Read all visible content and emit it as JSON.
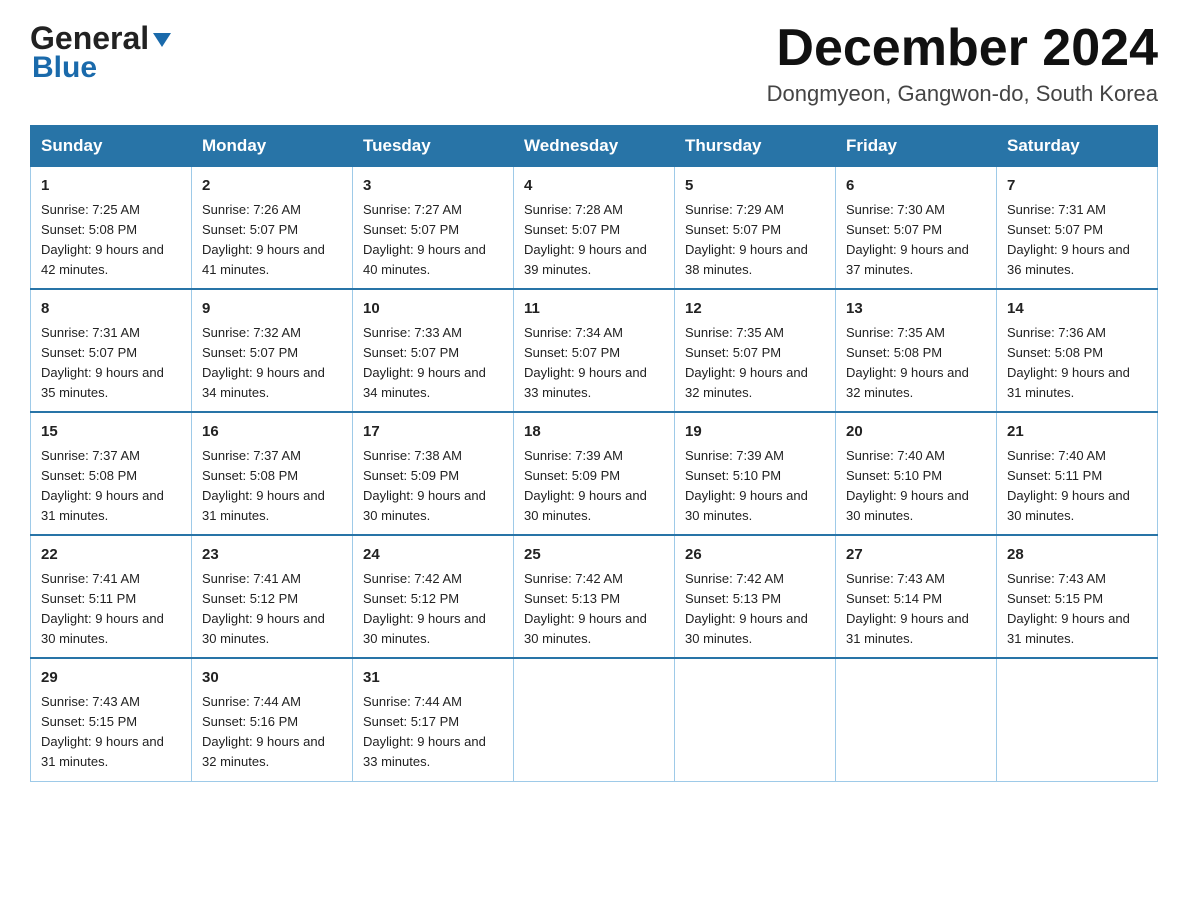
{
  "header": {
    "logo_line1": "General",
    "logo_line2": "Blue",
    "month_title": "December 2024",
    "location": "Dongmyeon, Gangwon-do, South Korea"
  },
  "weekdays": [
    "Sunday",
    "Monday",
    "Tuesday",
    "Wednesday",
    "Thursday",
    "Friday",
    "Saturday"
  ],
  "weeks": [
    [
      {
        "day": "1",
        "sunrise": "Sunrise: 7:25 AM",
        "sunset": "Sunset: 5:08 PM",
        "daylight": "Daylight: 9 hours and 42 minutes."
      },
      {
        "day": "2",
        "sunrise": "Sunrise: 7:26 AM",
        "sunset": "Sunset: 5:07 PM",
        "daylight": "Daylight: 9 hours and 41 minutes."
      },
      {
        "day": "3",
        "sunrise": "Sunrise: 7:27 AM",
        "sunset": "Sunset: 5:07 PM",
        "daylight": "Daylight: 9 hours and 40 minutes."
      },
      {
        "day": "4",
        "sunrise": "Sunrise: 7:28 AM",
        "sunset": "Sunset: 5:07 PM",
        "daylight": "Daylight: 9 hours and 39 minutes."
      },
      {
        "day": "5",
        "sunrise": "Sunrise: 7:29 AM",
        "sunset": "Sunset: 5:07 PM",
        "daylight": "Daylight: 9 hours and 38 minutes."
      },
      {
        "day": "6",
        "sunrise": "Sunrise: 7:30 AM",
        "sunset": "Sunset: 5:07 PM",
        "daylight": "Daylight: 9 hours and 37 minutes."
      },
      {
        "day": "7",
        "sunrise": "Sunrise: 7:31 AM",
        "sunset": "Sunset: 5:07 PM",
        "daylight": "Daylight: 9 hours and 36 minutes."
      }
    ],
    [
      {
        "day": "8",
        "sunrise": "Sunrise: 7:31 AM",
        "sunset": "Sunset: 5:07 PM",
        "daylight": "Daylight: 9 hours and 35 minutes."
      },
      {
        "day": "9",
        "sunrise": "Sunrise: 7:32 AM",
        "sunset": "Sunset: 5:07 PM",
        "daylight": "Daylight: 9 hours and 34 minutes."
      },
      {
        "day": "10",
        "sunrise": "Sunrise: 7:33 AM",
        "sunset": "Sunset: 5:07 PM",
        "daylight": "Daylight: 9 hours and 34 minutes."
      },
      {
        "day": "11",
        "sunrise": "Sunrise: 7:34 AM",
        "sunset": "Sunset: 5:07 PM",
        "daylight": "Daylight: 9 hours and 33 minutes."
      },
      {
        "day": "12",
        "sunrise": "Sunrise: 7:35 AM",
        "sunset": "Sunset: 5:07 PM",
        "daylight": "Daylight: 9 hours and 32 minutes."
      },
      {
        "day": "13",
        "sunrise": "Sunrise: 7:35 AM",
        "sunset": "Sunset: 5:08 PM",
        "daylight": "Daylight: 9 hours and 32 minutes."
      },
      {
        "day": "14",
        "sunrise": "Sunrise: 7:36 AM",
        "sunset": "Sunset: 5:08 PM",
        "daylight": "Daylight: 9 hours and 31 minutes."
      }
    ],
    [
      {
        "day": "15",
        "sunrise": "Sunrise: 7:37 AM",
        "sunset": "Sunset: 5:08 PM",
        "daylight": "Daylight: 9 hours and 31 minutes."
      },
      {
        "day": "16",
        "sunrise": "Sunrise: 7:37 AM",
        "sunset": "Sunset: 5:08 PM",
        "daylight": "Daylight: 9 hours and 31 minutes."
      },
      {
        "day": "17",
        "sunrise": "Sunrise: 7:38 AM",
        "sunset": "Sunset: 5:09 PM",
        "daylight": "Daylight: 9 hours and 30 minutes."
      },
      {
        "day": "18",
        "sunrise": "Sunrise: 7:39 AM",
        "sunset": "Sunset: 5:09 PM",
        "daylight": "Daylight: 9 hours and 30 minutes."
      },
      {
        "day": "19",
        "sunrise": "Sunrise: 7:39 AM",
        "sunset": "Sunset: 5:10 PM",
        "daylight": "Daylight: 9 hours and 30 minutes."
      },
      {
        "day": "20",
        "sunrise": "Sunrise: 7:40 AM",
        "sunset": "Sunset: 5:10 PM",
        "daylight": "Daylight: 9 hours and 30 minutes."
      },
      {
        "day": "21",
        "sunrise": "Sunrise: 7:40 AM",
        "sunset": "Sunset: 5:11 PM",
        "daylight": "Daylight: 9 hours and 30 minutes."
      }
    ],
    [
      {
        "day": "22",
        "sunrise": "Sunrise: 7:41 AM",
        "sunset": "Sunset: 5:11 PM",
        "daylight": "Daylight: 9 hours and 30 minutes."
      },
      {
        "day": "23",
        "sunrise": "Sunrise: 7:41 AM",
        "sunset": "Sunset: 5:12 PM",
        "daylight": "Daylight: 9 hours and 30 minutes."
      },
      {
        "day": "24",
        "sunrise": "Sunrise: 7:42 AM",
        "sunset": "Sunset: 5:12 PM",
        "daylight": "Daylight: 9 hours and 30 minutes."
      },
      {
        "day": "25",
        "sunrise": "Sunrise: 7:42 AM",
        "sunset": "Sunset: 5:13 PM",
        "daylight": "Daylight: 9 hours and 30 minutes."
      },
      {
        "day": "26",
        "sunrise": "Sunrise: 7:42 AM",
        "sunset": "Sunset: 5:13 PM",
        "daylight": "Daylight: 9 hours and 30 minutes."
      },
      {
        "day": "27",
        "sunrise": "Sunrise: 7:43 AM",
        "sunset": "Sunset: 5:14 PM",
        "daylight": "Daylight: 9 hours and 31 minutes."
      },
      {
        "day": "28",
        "sunrise": "Sunrise: 7:43 AM",
        "sunset": "Sunset: 5:15 PM",
        "daylight": "Daylight: 9 hours and 31 minutes."
      }
    ],
    [
      {
        "day": "29",
        "sunrise": "Sunrise: 7:43 AM",
        "sunset": "Sunset: 5:15 PM",
        "daylight": "Daylight: 9 hours and 31 minutes."
      },
      {
        "day": "30",
        "sunrise": "Sunrise: 7:44 AM",
        "sunset": "Sunset: 5:16 PM",
        "daylight": "Daylight: 9 hours and 32 minutes."
      },
      {
        "day": "31",
        "sunrise": "Sunrise: 7:44 AM",
        "sunset": "Sunset: 5:17 PM",
        "daylight": "Daylight: 9 hours and 33 minutes."
      },
      null,
      null,
      null,
      null
    ]
  ]
}
